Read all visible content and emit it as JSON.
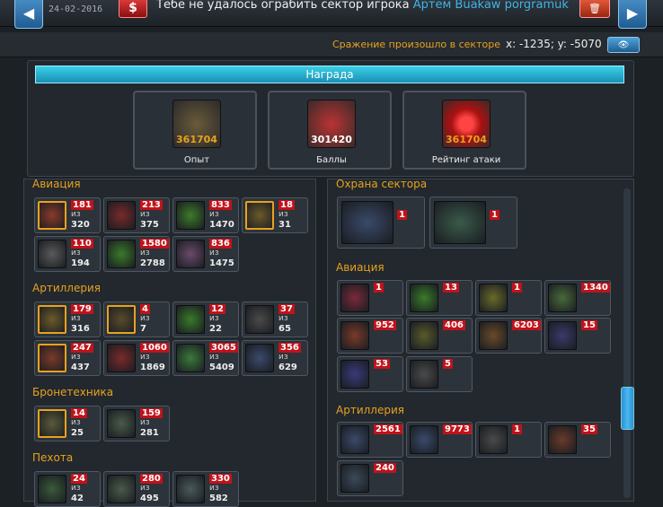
{
  "header": {
    "date": "24-02-2016",
    "dollar_label": "$",
    "message": "Тебе не удалось ограбить сектор игрока",
    "player": "Артём Buakaw porgramuk"
  },
  "sector": {
    "label": "Сражение произошло в секторе",
    "coords": "x: -1235; y: -5070"
  },
  "reward": {
    "title": "Награда",
    "items": [
      {
        "value": "361704",
        "name": "Опыт",
        "color": "#e8a21e"
      },
      {
        "value": "301420",
        "name": "Баллы",
        "color": "#ffffff"
      },
      {
        "value": "361704",
        "name": "Рейтинг атаки",
        "color": "#e8a21e"
      }
    ]
  },
  "left_sections": [
    {
      "title": "Авиация"
    },
    {
      "title": "Артиллерия"
    },
    {
      "title": "Бронетехника"
    },
    {
      "title": "Пехота"
    }
  ],
  "right_sections": [
    {
      "title": "Охрана сектора"
    },
    {
      "title": "Авиация"
    },
    {
      "title": "Артиллерия"
    }
  ],
  "iz": "из",
  "left_units": [
    {
      "v1": "181",
      "v2": "320",
      "rank": true,
      "tint": "#8a3a2a"
    },
    {
      "v1": "213",
      "v2": "375",
      "rank": false,
      "tint": "#7a2a2a"
    },
    {
      "v1": "833",
      "v2": "1470",
      "rank": false,
      "tint": "#3d7a2a"
    },
    {
      "v1": "18",
      "v2": "31",
      "rank": true,
      "tint": "#6a5a2a"
    },
    {
      "v1": "110",
      "v2": "194",
      "rank": false,
      "tint": "#5a5a5a"
    },
    {
      "v1": "1580",
      "v2": "2788",
      "rank": false,
      "tint": "#3a7a2a"
    },
    {
      "v1": "836",
      "v2": "1475",
      "rank": false,
      "tint": "#6a4a6a"
    },
    {
      "v1": "179",
      "v2": "316",
      "rank": true,
      "tint": "#6a5a2a"
    },
    {
      "v1": "4",
      "v2": "7",
      "rank": true,
      "tint": "#5a4a2a"
    },
    {
      "v1": "12",
      "v2": "22",
      "rank": false,
      "tint": "#3a7a2a"
    },
    {
      "v1": "37",
      "v2": "65",
      "rank": false,
      "tint": "#4a4a4a"
    },
    {
      "v1": "247",
      "v2": "437",
      "rank": true,
      "tint": "#7a3a2a"
    },
    {
      "v1": "1060",
      "v2": "1869",
      "rank": false,
      "tint": "#7a2a2a"
    },
    {
      "v1": "3065",
      "v2": "5409",
      "rank": false,
      "tint": "#3a7a3a"
    },
    {
      "v1": "356",
      "v2": "629",
      "rank": false,
      "tint": "#3a4a6a"
    },
    {
      "v1": "14",
      "v2": "25",
      "rank": true,
      "tint": "#5a5a3a"
    },
    {
      "v1": "159",
      "v2": "281",
      "rank": false,
      "tint": "#4a5a4a"
    },
    {
      "v1": "24",
      "v2": "42",
      "rank": false,
      "tint": "#3a5a3a"
    },
    {
      "v1": "280",
      "v2": "495",
      "rank": false,
      "tint": "#4a5a4a"
    },
    {
      "v1": "330",
      "v2": "582",
      "rank": false,
      "tint": "#4a5a5a"
    }
  ],
  "guard_units": [
    {
      "v1": "1",
      "tint": "#3a4a6a"
    },
    {
      "v1": "1",
      "tint": "#3a5a4a"
    }
  ],
  "right_units": [
    {
      "v1": "1",
      "tint": "#7a2a3a"
    },
    {
      "v1": "13",
      "tint": "#3a7a2a"
    },
    {
      "v1": "1",
      "tint": "#6a6a2a"
    },
    {
      "v1": "1340",
      "tint": "#4a6a3a"
    },
    {
      "v1": "952",
      "tint": "#7a3a2a"
    },
    {
      "v1": "406",
      "tint": "#5a5a2a"
    },
    {
      "v1": "6203",
      "tint": "#6a4a2a"
    },
    {
      "v1": "15",
      "tint": "#3a3a6a"
    },
    {
      "v1": "53",
      "tint": "#3a3a7a"
    },
    {
      "v1": "5",
      "tint": "#4a4a4a"
    },
    {
      "v1": "2561",
      "tint": "#3a4a6a"
    },
    {
      "v1": "9773",
      "tint": "#3a4a6a"
    },
    {
      "v1": "1",
      "tint": "#4a4a4a"
    },
    {
      "v1": "35",
      "tint": "#6a3a2a"
    },
    {
      "v1": "240",
      "tint": "#3a4a5a"
    }
  ]
}
